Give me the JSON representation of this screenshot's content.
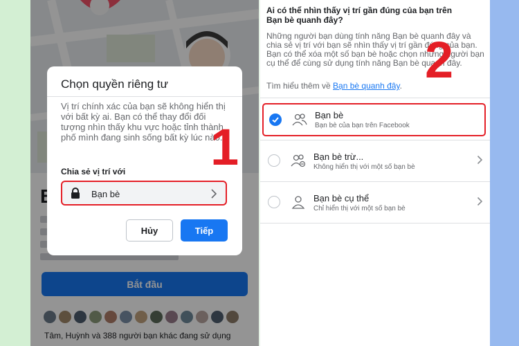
{
  "left_screen": {
    "intro_letter": "B",
    "start_button": "Bắt đầu",
    "friends_text": "Tâm, Huỳnh và 388 người bạn khác đang sử dụng",
    "dialog": {
      "title": "Chọn quyền riêng tư",
      "body": "Vị trí chính xác của bạn sẽ không hiển thị với bất kỳ ai. Bạn có thể thay đổi đối tượng nhìn thấy khu vực hoặc tỉnh thành phố mình đang sinh sống bất kỳ lúc nào.",
      "share_label": "Chia sẻ vị trí với",
      "audience": "Bạn bè",
      "cancel": "Hủy",
      "next": "Tiếp"
    },
    "step_number": "1"
  },
  "right_screen": {
    "question": "Ai có thể nhìn thấy vị trí gần đúng của bạn trên Bạn bè quanh đây?",
    "description": "Những người bạn dùng tính năng Bạn bè quanh đây và chia sẻ vị trí với bạn sẽ nhìn thấy vị trí gần đúng của bạn. Bạn có thể xóa một số bạn bè hoặc chọn những người bạn cụ thể để cùng sử dụng tính năng Bạn bè quanh đây.",
    "learn_more_prefix": "Tìm hiểu thêm về",
    "learn_more_link": "Bạn bè quanh đây",
    "learn_more_suffix": ".",
    "options": [
      {
        "title": "Bạn bè",
        "subtitle": "Bạn bè của bạn trên Facebook",
        "selected": true,
        "icon": "friends-icon"
      },
      {
        "title": "Bạn bè trừ...",
        "subtitle": "Không hiển thị với một số bạn bè",
        "selected": false,
        "icon": "friends-except-icon"
      },
      {
        "title": "Bạn bè cụ thể",
        "subtitle": "Chỉ hiển thị với một số bạn bè",
        "selected": false,
        "icon": "specific-friend-icon"
      }
    ],
    "step_number": "2"
  },
  "colors": {
    "accent": "#1877f2",
    "highlight_red": "#e41e26",
    "left_bg": "#d3efd3",
    "right_bg": "#97b9ef"
  }
}
